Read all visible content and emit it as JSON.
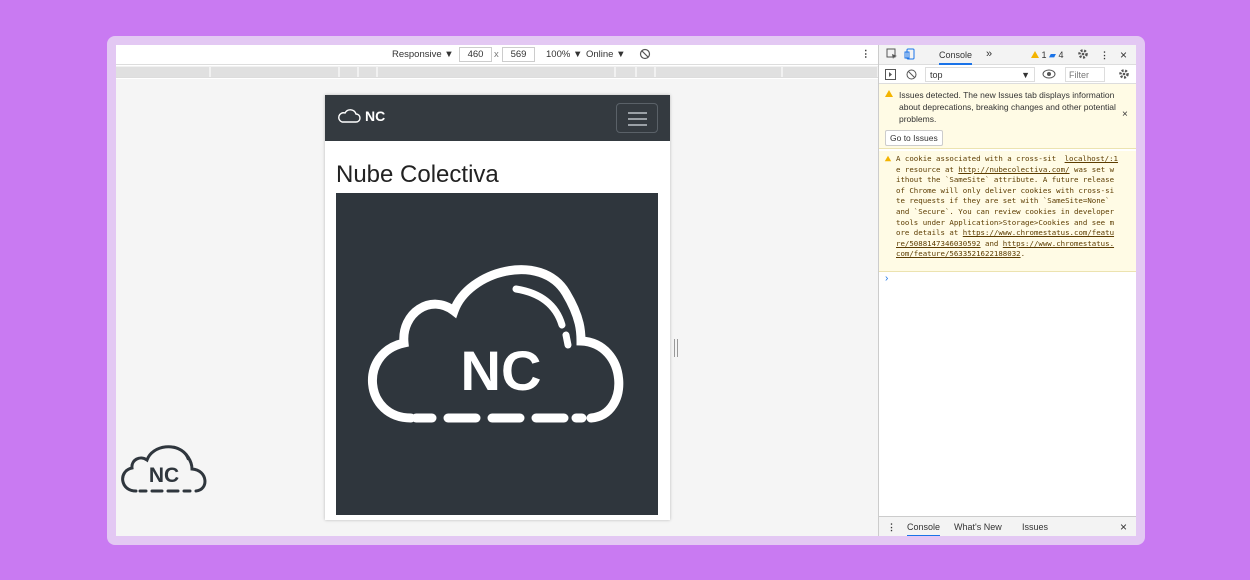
{
  "device_toolbar": {
    "mode": "Responsive",
    "mode_arrow": "▼",
    "width": "460",
    "times": "x",
    "height": "569",
    "zoom": "100%",
    "zoom_arrow": "▼",
    "network": "Online",
    "network_arrow": "▼",
    "more": "⋮"
  },
  "page": {
    "brand": "NC",
    "heading": "Nube Colectiva",
    "hero_logo_text": "NC"
  },
  "devtools": {
    "tab_console": "Console",
    "more_tabs": "»",
    "warning_count": "1",
    "message_count": "4",
    "context": "top",
    "filter_placeholder": "Filter",
    "issues_banner": "Issues detected. The new Issues tab displays information about deprecations, breaking changes and other potential problems.",
    "go_to_issues": "Go to Issues",
    "close": "×",
    "warning": {
      "source": "localhost/:1",
      "text_1": "A cookie associated with a cross-site resource at ",
      "link_1": "http://nubecolectiva.com/",
      "text_2": " was set without the `SameSite` attribute. A future release of Chrome will only deliver cookies with cross-site requests if they are set with `SameSite=None` and `Secure`. You can review cookies in developer tools under Application>Storage>Cookies and see more details at ",
      "link_2": "https://www.chromestatus.com/feature/5088147346030592",
      "text_3": " and ",
      "link_3": "https://www.chromestatus.com/feature/5633521622188032",
      "text_4": "."
    },
    "prompt": "›",
    "drawer_tabs": [
      "Console",
      "What's New",
      "Issues"
    ]
  },
  "colors": {
    "background": "#c97af2",
    "navbar": "#343a40",
    "hero": "#2f363d",
    "warning_bg": "#fffbe5"
  }
}
